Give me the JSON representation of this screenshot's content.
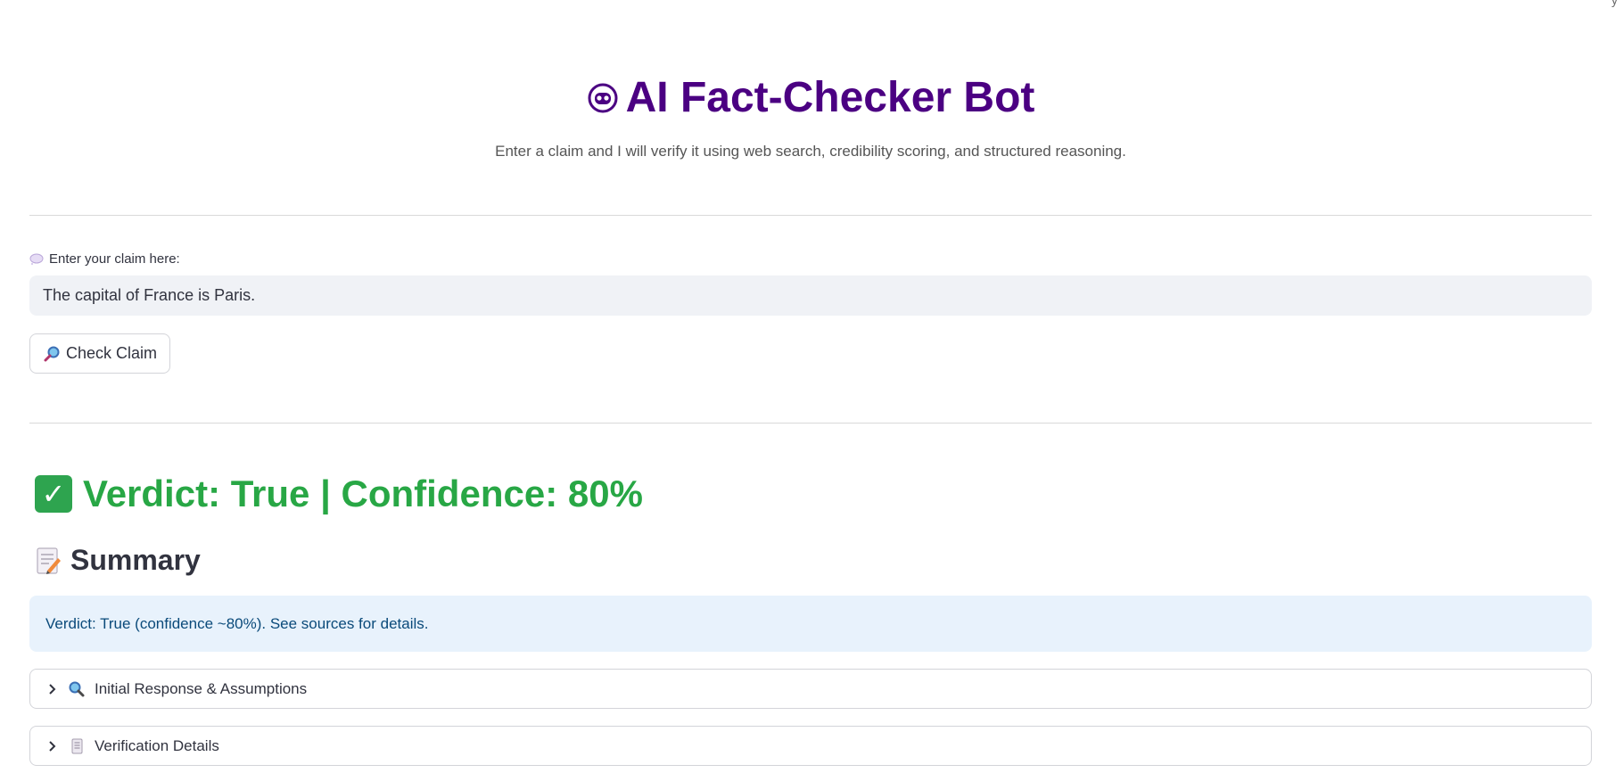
{
  "corner_text": "'y",
  "header": {
    "title": "AI Fact-Checker Bot",
    "subtitle": "Enter a claim and I will verify it using web search, credibility scoring, and structured reasoning."
  },
  "claim": {
    "label": "Enter your claim here:",
    "value": "The capital of France is Paris."
  },
  "check_button": {
    "label": "Check Claim"
  },
  "verdict": {
    "text": "Verdict: True | Confidence: 80%",
    "color": "#28a745"
  },
  "summary": {
    "heading": "Summary",
    "text": "Verdict: True (confidence ~80%). See sources for details."
  },
  "expanders": [
    {
      "label": "Initial Response & Assumptions",
      "icon": "magnifier-icon"
    },
    {
      "label": "Verification Details",
      "icon": "scroll-icon"
    }
  ],
  "colors": {
    "title": "#4b0082",
    "verdict": "#28a745",
    "info_bg": "#e8f2fc",
    "info_text": "#0a4a7a"
  }
}
